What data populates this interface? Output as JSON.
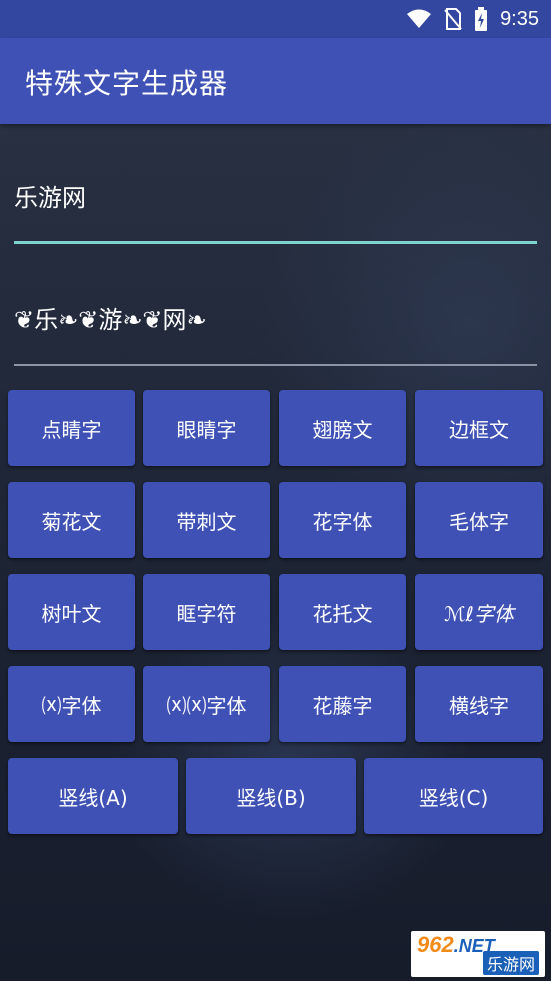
{
  "status_bar": {
    "time": "9:35",
    "icons": [
      "wifi-icon",
      "no-sim-icon",
      "battery-charging-icon"
    ]
  },
  "app_bar": {
    "title": "特殊文字生成器"
  },
  "input": {
    "value": "乐游网"
  },
  "output": {
    "value": "❦乐❧❦游❧❦网❧"
  },
  "buttons": [
    "点睛字",
    "眼睛字",
    "翅膀文",
    "边框文",
    "菊花文",
    "带刺文",
    "花字体",
    "毛体字",
    "树叶文",
    "眶字符",
    "花托文",
    "ℳℓ字体",
    "⒳字体",
    "⒳⒳字体",
    "花藤字",
    "横线字",
    "竖线(A)",
    "竖线(B)",
    "竖线(C)"
  ],
  "watermark": {
    "brand": "962",
    "net": ".NET",
    "site": "乐游网"
  },
  "colors": {
    "primary": "#3f51b5",
    "status_bar": "#3347a0",
    "input_underline": "#7fd3cf",
    "background": "#1e2434"
  }
}
